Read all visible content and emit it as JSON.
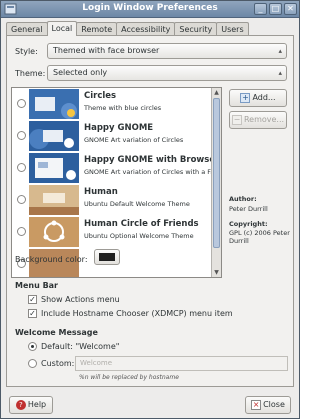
{
  "window": {
    "title": "Login Window Preferences",
    "close_glyph": "✕",
    "minimize_glyph": "_",
    "maximize_glyph": "□"
  },
  "tabs": [
    {
      "label": "General"
    },
    {
      "label": "Local"
    },
    {
      "label": "Remote"
    },
    {
      "label": "Accessibility"
    },
    {
      "label": "Security"
    },
    {
      "label": "Users"
    }
  ],
  "style": {
    "label": "Style:",
    "value": "Themed with face browser"
  },
  "theme": {
    "label": "Theme:",
    "value": "Selected only"
  },
  "themes": [
    {
      "name": "Circles",
      "desc": "Theme with blue circles"
    },
    {
      "name": "Happy GNOME",
      "desc": "GNOME Art variation of Circles"
    },
    {
      "name": "Happy GNOME with Browser",
      "desc": "GNOME Art variation of Circles with a Face"
    },
    {
      "name": "Human",
      "desc": "Ubuntu Default Welcome Theme"
    },
    {
      "name": "Human Circle of Friends",
      "desc": "Ubuntu Optional Welcome Theme"
    }
  ],
  "buttons": {
    "add": "Add...",
    "remove": "Remove...",
    "help": "Help",
    "close": "Close"
  },
  "author": {
    "label": "Author:",
    "value": "Peter Durrill"
  },
  "copyright": {
    "label": "Copyright:",
    "value": "GPL (c) 2006 Peter Durrill"
  },
  "background_color": {
    "label": "Background color:",
    "value": "#1f1f1f"
  },
  "menu_bar": {
    "title": "Menu Bar",
    "show_actions": {
      "label": "Show Actions menu",
      "checked": true
    },
    "hostname_chooser": {
      "label": "Include Hostname Chooser (XDMCP) menu item",
      "checked": true
    }
  },
  "welcome": {
    "title": "Welcome Message",
    "default": {
      "label": "Default: \"Welcome\"",
      "selected": true
    },
    "custom": {
      "label": "Custom:",
      "placeholder": "Welcome"
    },
    "hint": "%n will be replaced by hostname"
  },
  "colors": {
    "titlebar": "#7b93b0",
    "accent": "#b9c8dd"
  }
}
